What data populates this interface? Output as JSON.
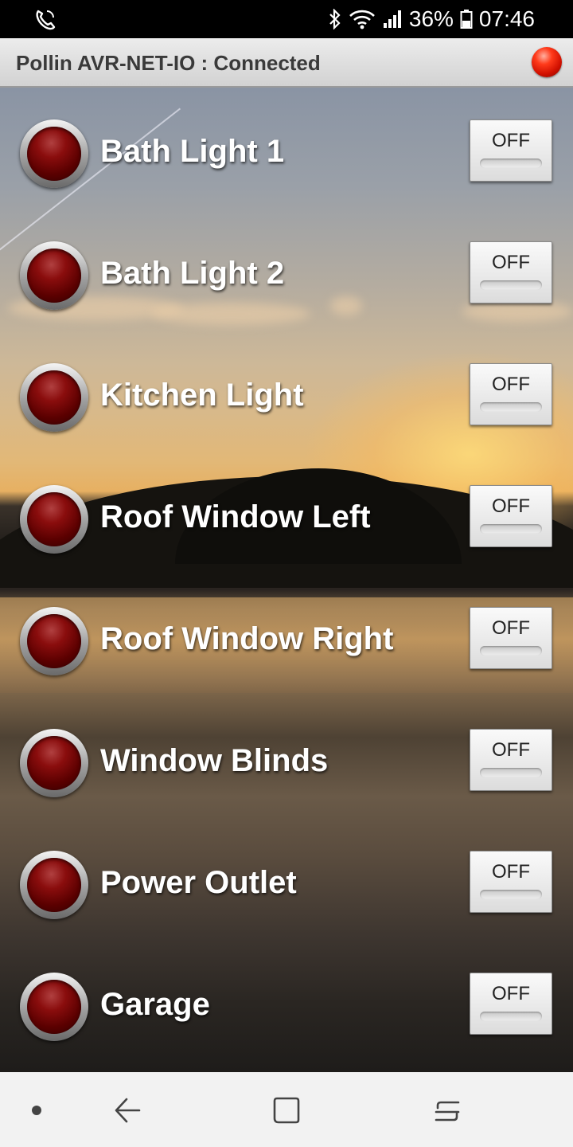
{
  "statusbar": {
    "battery": "36%",
    "time": "07:46",
    "icons": [
      "wifi-calling-icon",
      "bluetooth-icon",
      "wifi-icon",
      "signal-icon",
      "battery-icon"
    ]
  },
  "app": {
    "title": "Pollin AVR-NET-IO : Connected",
    "status_led_color": "#e01a00"
  },
  "switches": [
    {
      "label": "Bath Light 1",
      "state": "OFF"
    },
    {
      "label": "Bath Light 2",
      "state": "OFF"
    },
    {
      "label": "Kitchen Light",
      "state": "OFF"
    },
    {
      "label": "Roof Window Left",
      "state": "OFF"
    },
    {
      "label": "Roof Window Right",
      "state": "OFF"
    },
    {
      "label": "Window Blinds",
      "state": "OFF"
    },
    {
      "label": "Power Outlet",
      "state": "OFF"
    },
    {
      "label": "Garage",
      "state": "OFF"
    }
  ],
  "navbar": {
    "icons": [
      "dot-icon",
      "back-icon",
      "home-icon",
      "recent-apps-icon"
    ]
  }
}
